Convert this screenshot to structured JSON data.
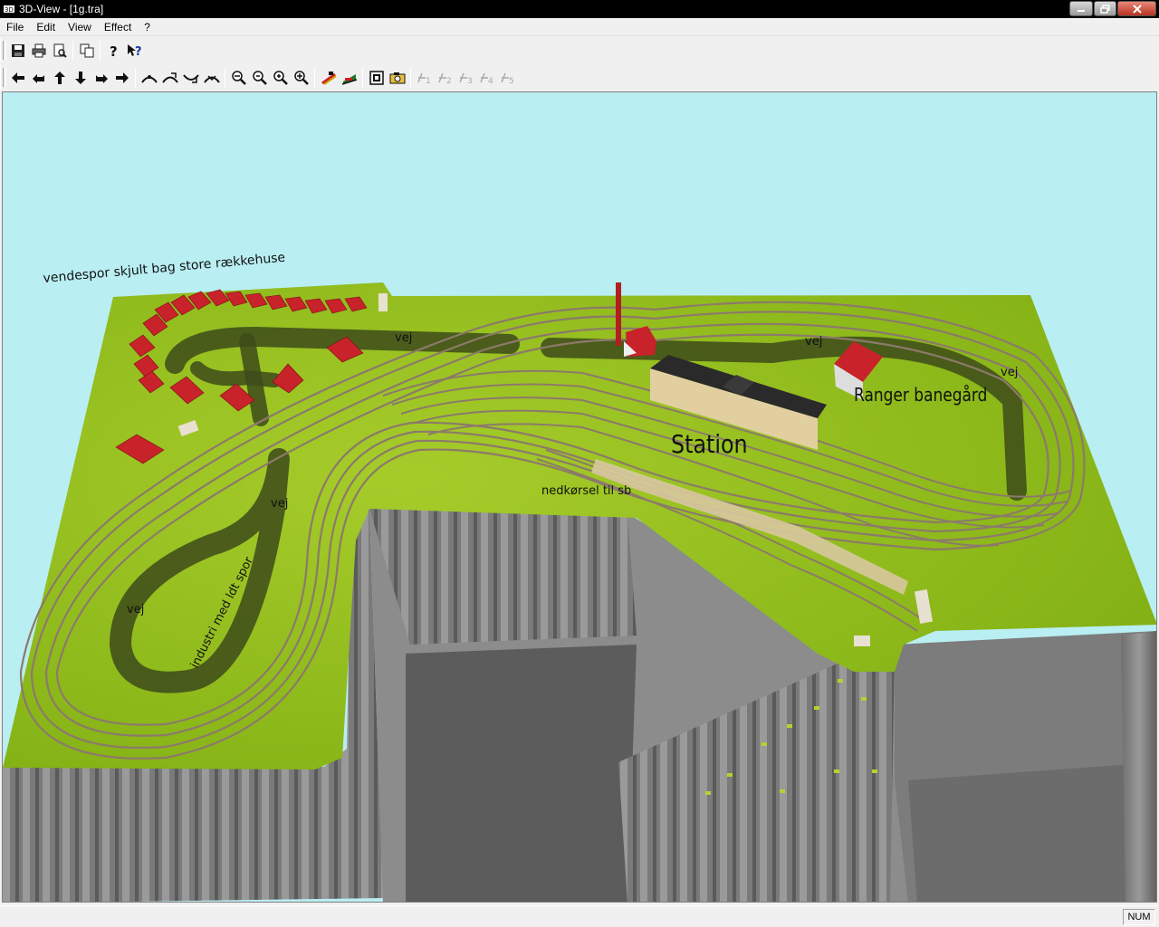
{
  "window": {
    "title": "3D-View - [1g.tra]"
  },
  "menu": {
    "items": [
      "File",
      "Edit",
      "View",
      "Effect",
      "?"
    ]
  },
  "toolbar1": {
    "buttons": [
      "save-icon",
      "print-icon",
      "print-preview-icon",
      "copy-icon",
      "help-icon",
      "context-help-icon"
    ]
  },
  "toolbar2": {
    "buttons": [
      "arrow-left-icon",
      "arrow-back-icon",
      "arrow-up-icon",
      "arrow-down-icon",
      "arrow-forward-icon",
      "arrow-right-icon",
      "walk-1-icon",
      "walk-2-icon",
      "walk-3-icon",
      "walk-4-icon",
      "zoom-out-icon",
      "zoom-out-small-icon",
      "zoom-in-small-icon",
      "zoom-in-icon",
      "train-icon",
      "locomotive-icon",
      "fit-view-icon",
      "camera-icon",
      "viewpoint-1-icon",
      "viewpoint-2-icon",
      "viewpoint-3-icon",
      "viewpoint-4-icon",
      "viewpoint-5-icon"
    ],
    "viewpoint_labels": [
      "1",
      "2",
      "3",
      "4",
      "5"
    ]
  },
  "scene": {
    "labels": {
      "vendespor": "vendespor skjult bag store rækkehuse",
      "vej1": "vej",
      "vej2": "vej",
      "vej3": "vej",
      "vej4": "vej",
      "vej5": "vej",
      "station": "Station",
      "ranger": "Ranger banegård",
      "nedkorsel": "nedkørsel til sb",
      "industri": "industri med ldt spor"
    },
    "colors": {
      "sky": "#b9eef2",
      "grass": "#8fc01c",
      "road": "#3d4a1a",
      "track": "#8c7a6a",
      "cliff": "#7d7d7d",
      "roof": "#c8222a"
    }
  },
  "status": {
    "num": "NUM"
  }
}
